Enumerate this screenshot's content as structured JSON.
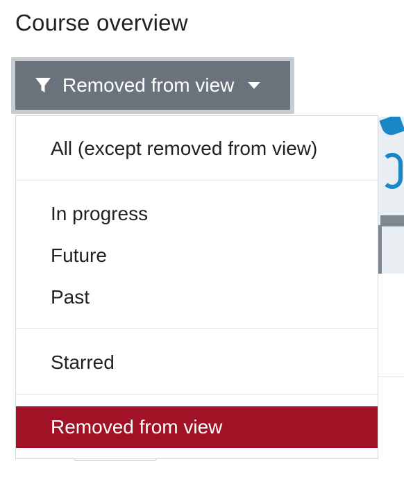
{
  "header": {
    "title": "Course overview"
  },
  "filter": {
    "button_label": "Removed from view",
    "icon": "filter-icon",
    "caret_icon": "caret-down-icon"
  },
  "dropdown": {
    "items": [
      {
        "label": "All (except removed from view)",
        "selected": false
      },
      {
        "label": "In progress",
        "selected": false
      },
      {
        "label": "Future",
        "selected": false
      },
      {
        "label": "Past",
        "selected": false
      },
      {
        "label": "Starred",
        "selected": false
      },
      {
        "label": "Removed from view",
        "selected": true
      }
    ]
  },
  "colors": {
    "button_bg": "#6a737b",
    "selected_bg": "#a11226",
    "text": "#1d2125"
  }
}
